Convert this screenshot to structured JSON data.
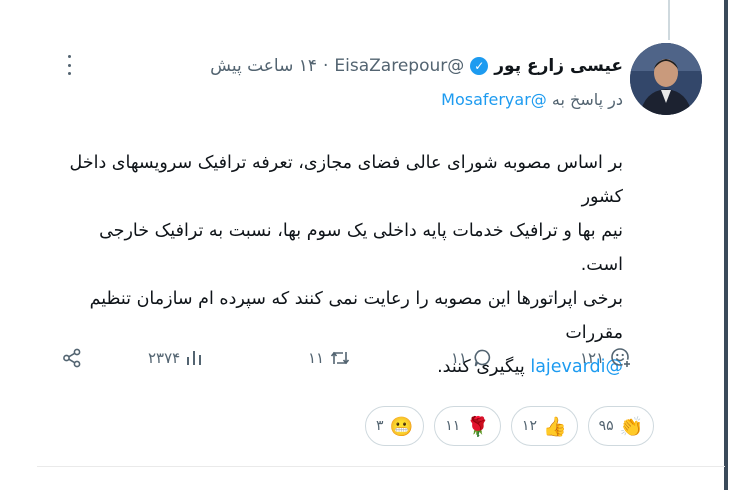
{
  "author": {
    "name": "عیسی زارع پور",
    "handle": "@EisaZarepour",
    "separator": "·",
    "time": "۱۴ ساعت پیش",
    "verified_color": "#1d9bf0"
  },
  "reply_to": {
    "prefix": "در پاسخ به",
    "mention": "@Mosaferyar"
  },
  "tweet": {
    "line1": "بر اساس مصوبه شورای عالی فضای مجازی، تعرفه ترافیک سرویسهای داخل کشور",
    "line2": "نیم بها و ترافیک خدمات پایه داخلی یک سوم بها، نسبت به ترافیک خارجی است.",
    "line3": "برخی اپراتورها این مصوبه را رعایت نمی کنند که سپرده ام سازمان تنظیم مقررات",
    "mention": "@lajevardi",
    "line4_rest": "پیگیری کنند."
  },
  "actions": {
    "reactions_count": "۱۲۱",
    "replies_count": "۱۱",
    "retweets_count": "۱۱",
    "views_count": "۲۳۷۴"
  },
  "reactions": [
    {
      "icon": "clap-icon",
      "emoji": "👏",
      "count": "۹۵"
    },
    {
      "icon": "thumbs-up-icon",
      "emoji": "👍",
      "count": "۱۲"
    },
    {
      "icon": "rose-icon",
      "emoji": "🌹",
      "count": "۱۱"
    },
    {
      "icon": "grin-icon",
      "emoji": "😬",
      "count": "۳"
    }
  ]
}
